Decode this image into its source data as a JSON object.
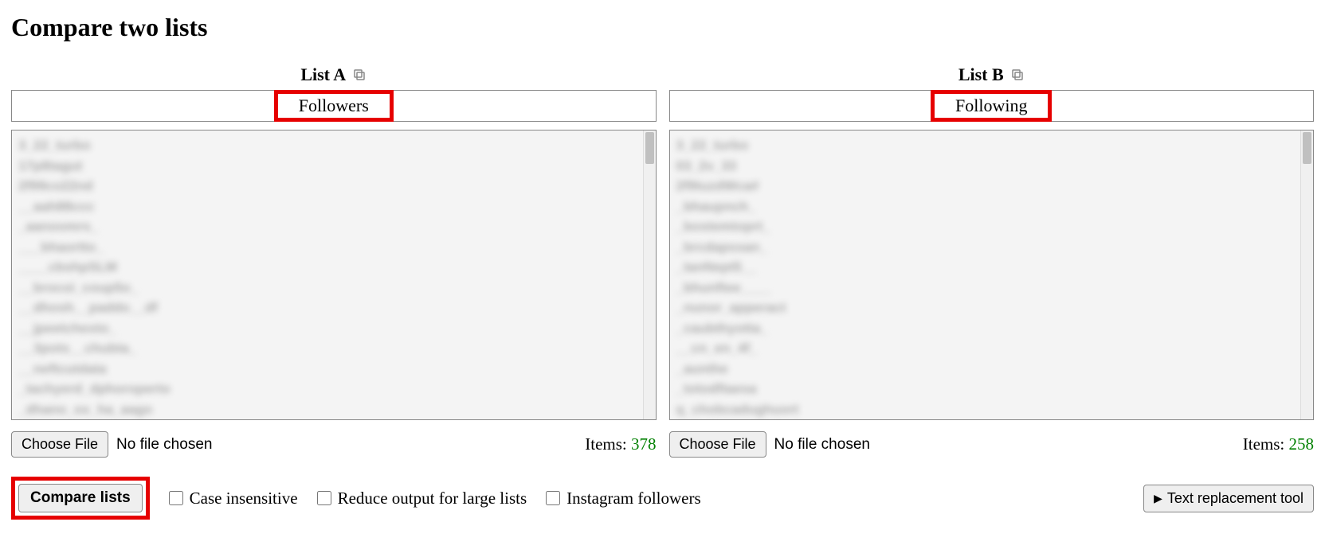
{
  "page": {
    "title": "Compare two lists"
  },
  "listA": {
    "header": "List A",
    "name_value": "Followers",
    "choose_file_label": "Choose File",
    "no_file_text": "No file chosen",
    "items_label": "Items:",
    "items_count": "378"
  },
  "listB": {
    "header": "List B",
    "name_value": "Following",
    "choose_file_label": "Choose File",
    "no_file_text": "No file chosen",
    "items_label": "Items:",
    "items_count": "258"
  },
  "controls": {
    "compare_label": "Compare lists",
    "case_insensitive_label": "Case insensitive",
    "reduce_output_label": "Reduce output for large lists",
    "instagram_label": "Instagram followers",
    "text_replacement_label": "Text replacement tool"
  }
}
